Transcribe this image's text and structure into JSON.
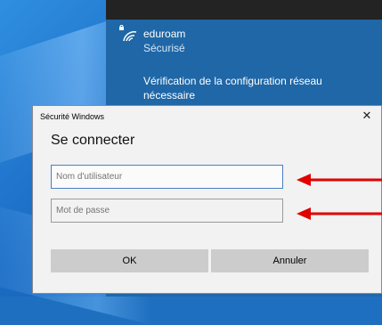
{
  "network": {
    "name": "eduroam",
    "status": "Sécurisé",
    "message": "Vérification de la configuration réseau nécessaire"
  },
  "dialog": {
    "window_title": "Sécurité Windows",
    "heading": "Se connecter",
    "close_glyph": "✕",
    "username_placeholder": "Nom d'utilisateur",
    "password_placeholder": "Mot de passe",
    "ok_label": "OK",
    "cancel_label": "Annuler"
  },
  "colors": {
    "flyout_bg": "#1f67a7",
    "annotation_arrow": "#e00000",
    "field_focus_border": "#4a7fc0"
  },
  "icons": {
    "network": "wifi-lock-icon",
    "close": "close-icon",
    "annotations": "red-arrow-icon"
  }
}
